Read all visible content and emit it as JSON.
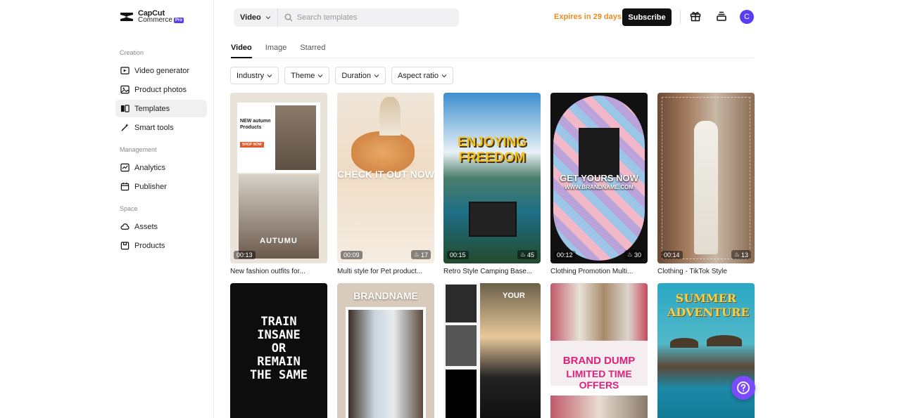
{
  "brand": {
    "name_line1": "CapCut",
    "name_line2": "Commerce",
    "badge": "Pro"
  },
  "sidebar": {
    "sections": [
      {
        "label": "Creation",
        "items": [
          {
            "label": "Video generator",
            "icon": "video-add-icon"
          },
          {
            "label": "Product photos",
            "icon": "image-icon"
          },
          {
            "label": "Templates",
            "icon": "templates-icon",
            "active": true
          },
          {
            "label": "Smart tools",
            "icon": "magic-wand-icon"
          }
        ]
      },
      {
        "label": "Management",
        "items": [
          {
            "label": "Analytics",
            "icon": "chart-icon"
          },
          {
            "label": "Publisher",
            "icon": "calendar-icon"
          }
        ]
      },
      {
        "label": "Space",
        "items": [
          {
            "label": "Assets",
            "icon": "cloud-icon"
          },
          {
            "label": "Products",
            "icon": "box-icon"
          }
        ]
      }
    ]
  },
  "header": {
    "type_select": "Video",
    "search_placeholder": "Search templates",
    "expires": "Expires in 29 days",
    "subscribe": "Subscribe",
    "avatar_initial": "C"
  },
  "tabs": [
    {
      "label": "Video",
      "active": true
    },
    {
      "label": "Image"
    },
    {
      "label": "Starred"
    }
  ],
  "filters": [
    "Industry",
    "Theme",
    "Duration",
    "Aspect ratio"
  ],
  "templates": [
    {
      "title": "New fashion outfits for...",
      "duration": "00:13",
      "uses": "",
      "overlay": "AUTUMU",
      "overlay2": "NEW autumn Products",
      "badge": "SHOP NOW"
    },
    {
      "title": "Multi style for Pet product...",
      "duration": "00:09",
      "uses": "17",
      "overlay": "CHECK IT OUT NOW"
    },
    {
      "title": "Retro Style Camping Base...",
      "duration": "00:15",
      "uses": "45",
      "overlay": "ENJOYING FREEDOM"
    },
    {
      "title": "Clothing Promotion Multi...",
      "duration": "00:12",
      "uses": "30",
      "overlay": "GET YOURS NOW",
      "overlay2": "WWW.BRANDNAME.COM"
    },
    {
      "title": "Clothing - TikTok Style",
      "duration": "00:14",
      "uses": "13",
      "overlay": ""
    },
    {
      "title": "",
      "duration": "",
      "uses": "",
      "overlay": "TRAIN INSANE OR REMAIN THE SAME"
    },
    {
      "title": "",
      "duration": "",
      "uses": "",
      "overlay": "BRANDNAME"
    },
    {
      "title": "",
      "duration": "",
      "uses": "",
      "overlay": "YOUR"
    },
    {
      "title": "",
      "duration": "",
      "uses": "",
      "overlay": "BRAND DUMP",
      "overlay2": "LIMITED TIME OFFERS"
    },
    {
      "title": "",
      "duration": "",
      "uses": "",
      "overlay": "SUMMER ADVENTURE"
    }
  ]
}
